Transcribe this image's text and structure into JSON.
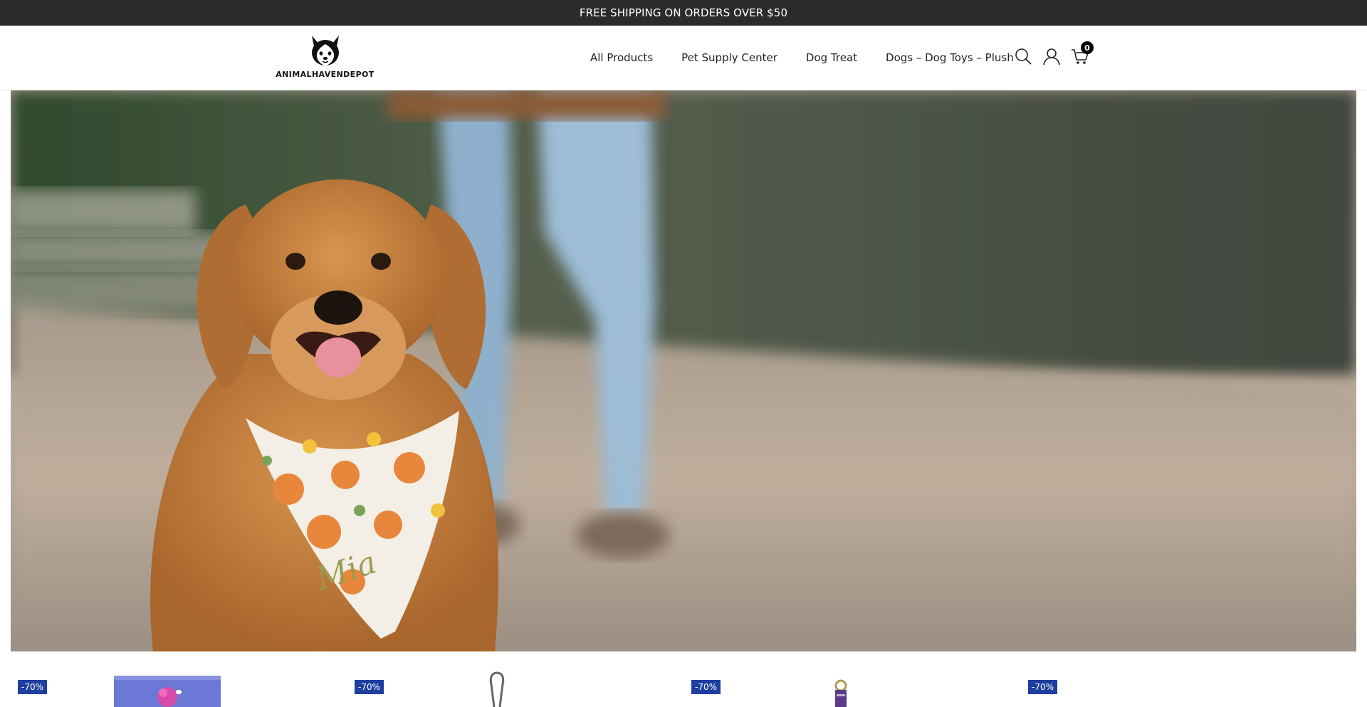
{
  "announcement": {
    "text": "FREE SHIPPING ON ORDERS OVER $50"
  },
  "header": {
    "logo_text": "ANIMALHAVENDEPOT",
    "nav": [
      {
        "label": "All Products"
      },
      {
        "label": "Pet Supply Center"
      },
      {
        "label": "Dog Treat"
      },
      {
        "label": "Dogs – Dog Toys – Plush"
      }
    ],
    "icons": {
      "search": "search-icon",
      "account": "user-icon",
      "cart": "cart-icon"
    },
    "cart_count": "0"
  },
  "hero": {
    "bandana_text": "Mia"
  },
  "products": [
    {
      "discount": "-70%"
    },
    {
      "discount": "-70%"
    },
    {
      "discount": "-70%"
    },
    {
      "discount": "-70%"
    }
  ],
  "colors": {
    "announcement_bg": "#2b2b2b",
    "badge_bg": "#1e3fa0"
  }
}
